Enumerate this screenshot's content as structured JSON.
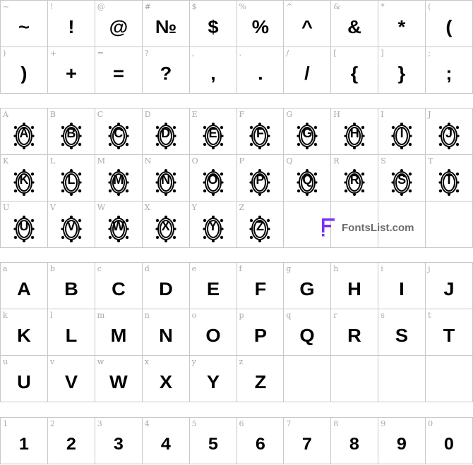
{
  "symbols": [
    {
      "label": "~",
      "glyph": "~"
    },
    {
      "label": "!",
      "glyph": "!"
    },
    {
      "label": "@",
      "glyph": "@"
    },
    {
      "label": "#",
      "glyph": "№"
    },
    {
      "label": "$",
      "glyph": "$"
    },
    {
      "label": "%",
      "glyph": "%"
    },
    {
      "label": "^",
      "glyph": "^"
    },
    {
      "label": "&",
      "glyph": "&"
    },
    {
      "label": "*",
      "glyph": "*"
    },
    {
      "label": "(",
      "glyph": "("
    },
    {
      "label": ")",
      "glyph": ")"
    },
    {
      "label": "+",
      "glyph": "+"
    },
    {
      "label": "=",
      "glyph": "="
    },
    {
      "label": "?",
      "glyph": "?"
    },
    {
      "label": ",",
      "glyph": ","
    },
    {
      "label": ".",
      "glyph": "."
    },
    {
      "label": "/",
      "glyph": "/"
    },
    {
      "label": "[",
      "glyph": "{"
    },
    {
      "label": "]",
      "glyph": "}"
    },
    {
      "label": ";",
      "glyph": ";"
    }
  ],
  "uppercase": [
    "A",
    "B",
    "C",
    "D",
    "E",
    "F",
    "G",
    "H",
    "I",
    "J",
    "K",
    "L",
    "M",
    "N",
    "O",
    "P",
    "Q",
    "R",
    "S",
    "T",
    "U",
    "V",
    "W",
    "X",
    "Y",
    "Z"
  ],
  "lowercase": [
    {
      "label": "a",
      "glyph": "A"
    },
    {
      "label": "b",
      "glyph": "B"
    },
    {
      "label": "c",
      "glyph": "C"
    },
    {
      "label": "d",
      "glyph": "D"
    },
    {
      "label": "e",
      "glyph": "E"
    },
    {
      "label": "f",
      "glyph": "F"
    },
    {
      "label": "g",
      "glyph": "G"
    },
    {
      "label": "h",
      "glyph": "H"
    },
    {
      "label": "i",
      "glyph": "I"
    },
    {
      "label": "j",
      "glyph": "J"
    },
    {
      "label": "k",
      "glyph": "K"
    },
    {
      "label": "l",
      "glyph": "L"
    },
    {
      "label": "m",
      "glyph": "M"
    },
    {
      "label": "n",
      "glyph": "N"
    },
    {
      "label": "o",
      "glyph": "O"
    },
    {
      "label": "p",
      "glyph": "P"
    },
    {
      "label": "q",
      "glyph": "Q"
    },
    {
      "label": "r",
      "glyph": "R"
    },
    {
      "label": "s",
      "glyph": "S"
    },
    {
      "label": "t",
      "glyph": "T"
    },
    {
      "label": "u",
      "glyph": "U"
    },
    {
      "label": "v",
      "glyph": "V"
    },
    {
      "label": "w",
      "glyph": "W"
    },
    {
      "label": "x",
      "glyph": "X"
    },
    {
      "label": "y",
      "glyph": "Y"
    },
    {
      "label": "z",
      "glyph": "Z"
    }
  ],
  "numbers": [
    {
      "label": "1",
      "glyph": "1"
    },
    {
      "label": "2",
      "glyph": "2"
    },
    {
      "label": "3",
      "glyph": "3"
    },
    {
      "label": "4",
      "glyph": "4"
    },
    {
      "label": "5",
      "glyph": "5"
    },
    {
      "label": "6",
      "glyph": "6"
    },
    {
      "label": "7",
      "glyph": "7"
    },
    {
      "label": "8",
      "glyph": "8"
    },
    {
      "label": "9",
      "glyph": "9"
    },
    {
      "label": "0",
      "glyph": "0"
    }
  ],
  "brand": {
    "text": "FontsList.com",
    "accent": "#7b2ff7"
  },
  "colors": {
    "grid": "#c8c8c8",
    "label": "#a8a8a8",
    "glyph": "#000000"
  }
}
